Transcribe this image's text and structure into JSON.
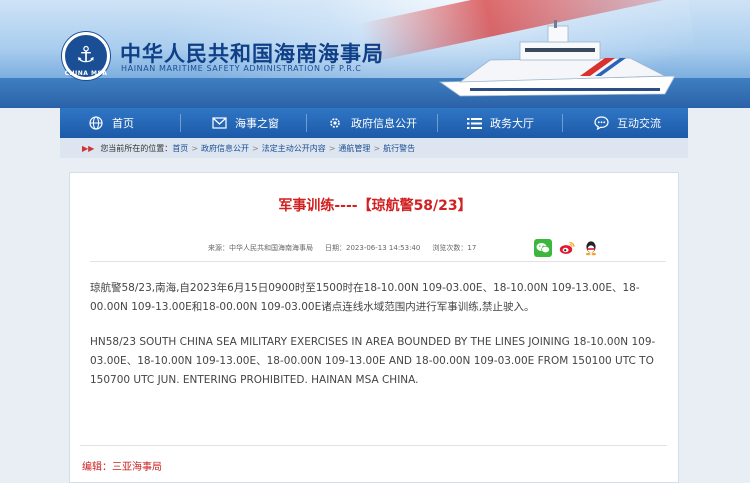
{
  "header": {
    "site_title": "中华人民共和国海南海事局",
    "site_subtitle": "HAINAN MARITIME SAFETY ADMINISTRATION OF P.R.C",
    "logo_caption": "CHINA MSA",
    "logo_icon": "anchor-icon"
  },
  "nav": {
    "items": [
      {
        "label": "首页",
        "icon": "globe-icon"
      },
      {
        "label": "海事之窗",
        "icon": "mail-icon"
      },
      {
        "label": "政府信息公开",
        "icon": "gear-icon"
      },
      {
        "label": "政务大厅",
        "icon": "list-icon"
      },
      {
        "label": "互动交流",
        "icon": "chat-icon"
      }
    ]
  },
  "breadcrumb": {
    "prefix": "您当前所在的位置：",
    "items": [
      "首页",
      "政府信息公开",
      "法定主动公开内容",
      "通航管理",
      "航行警告"
    ],
    "separator": ">"
  },
  "article": {
    "title": "军事训练----【琼航警58/23】",
    "source": "来源：中华人民共和国海南海事局",
    "date": "日期：2023-06-13 14:53:40",
    "views": "浏览次数：17",
    "paragraph_cn": "琼航警58/23,南海,自2023年6月15日0900时至1500时在18-10.00N 109-03.00E、18-10.00N 109-13.00E、18-00.00N 109-13.00E和18-00.00N 109-03.00E诸点连线水域范围内进行军事训练,禁止驶入。",
    "paragraph_en": "HN58/23  SOUTH CHINA SEA  MILITARY EXERCISES  IN AREA BOUNDED BY THE LINES JOINING 18-10.00N 109-03.00E、18-10.00N 109-13.00E、18-00.00N 109-13.00E  AND 18-00.00N 109-03.00E FROM 150100  UTC  TO 150700  UTC JUN.  ENTERING PROHIBITED. HAINAN MSA CHINA.",
    "editor": "编辑：三亚海事局"
  },
  "share": [
    {
      "icon": "wechat-icon",
      "color": "#3bb83b"
    },
    {
      "icon": "weibo-icon",
      "color": "#e6162d"
    },
    {
      "icon": "qq-icon",
      "color": "#1a8fd6"
    }
  ],
  "colors": {
    "nav_bg": "#1c5aa8",
    "title_red": "#d21f1f",
    "brand_blue": "#0f3f86"
  }
}
